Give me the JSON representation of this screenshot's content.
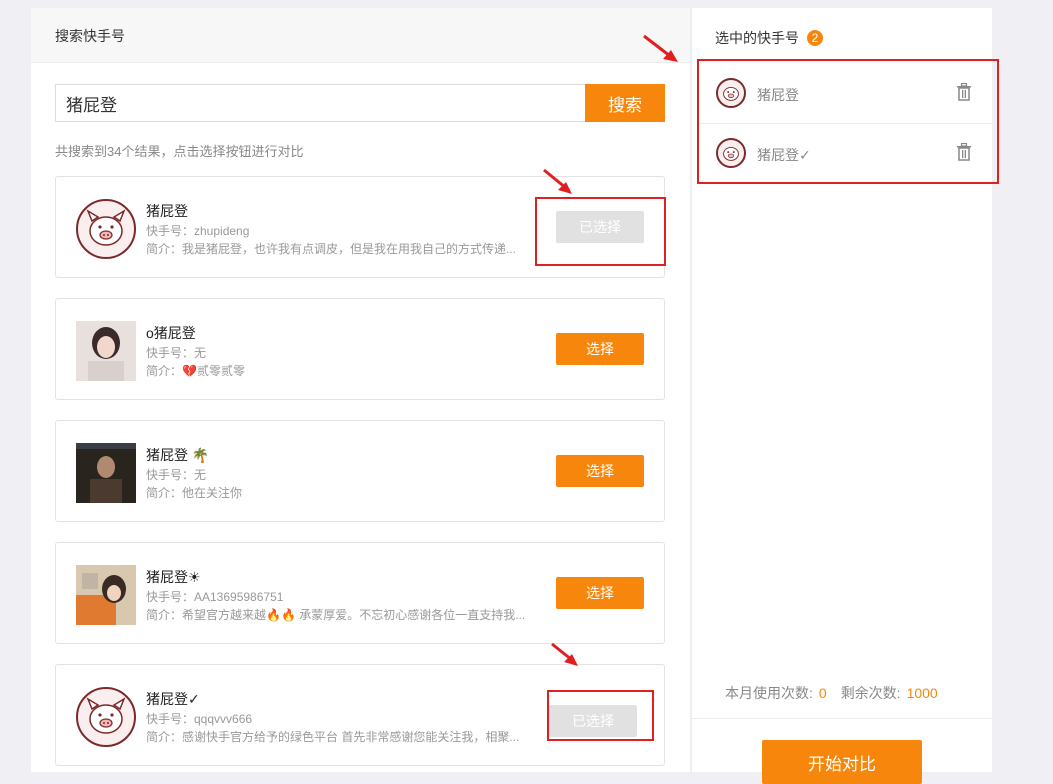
{
  "search": {
    "header": "搜索快手号",
    "value": "猪屁登",
    "button_label": "搜索",
    "summary": "共搜索到34个结果，点击选择按钮进行对比"
  },
  "results": [
    {
      "name": "猪屁登",
      "id_line": "快手号：zhupideng",
      "bio": "简介：我是猪屁登，也许我有点调皮，但是我在用我自己的方式传递...",
      "button": "已选择",
      "selected": true,
      "avatar": "pig-avatar"
    },
    {
      "name": "o猪屁登",
      "id_line": "快手号：无",
      "bio": "简介：💔贰零贰零",
      "button": "选择",
      "selected": false,
      "avatar": "photo-avatar"
    },
    {
      "name": "猪屁登 🌴",
      "id_line": "快手号：无",
      "bio": "简介：他在关注你",
      "button": "选择",
      "selected": false,
      "avatar": "photo-avatar"
    },
    {
      "name": "猪屁登☀",
      "id_line": "快手号：AA13695986751",
      "bio": "简介：希望官方越来越🔥🔥 承蒙厚爱。不忘初心感谢各位一直支持我...",
      "button": "选择",
      "selected": false,
      "avatar": "photo-avatar"
    },
    {
      "name": "猪屁登✓",
      "id_line": "快手号：qqqvvv666",
      "bio": "简介：感谢快手官方给予的绿色平台 首先非常感谢您能关注我，相聚...",
      "button": "已选择",
      "selected": true,
      "avatar": "pig-avatar"
    }
  ],
  "selected_panel": {
    "title": "选中的快手号",
    "count": "2",
    "items": [
      {
        "name": "猪屁登"
      },
      {
        "name": "猪屁登✓"
      }
    ]
  },
  "usage": {
    "month_label": "本月使用次数:",
    "month_value": "0",
    "remaining_label": "剩余次数:",
    "remaining_value": "1000"
  },
  "start_button": "开始对比",
  "colors": {
    "accent": "#f7870c",
    "annotation": "#e02020",
    "disabled": "#e1e1e1"
  }
}
